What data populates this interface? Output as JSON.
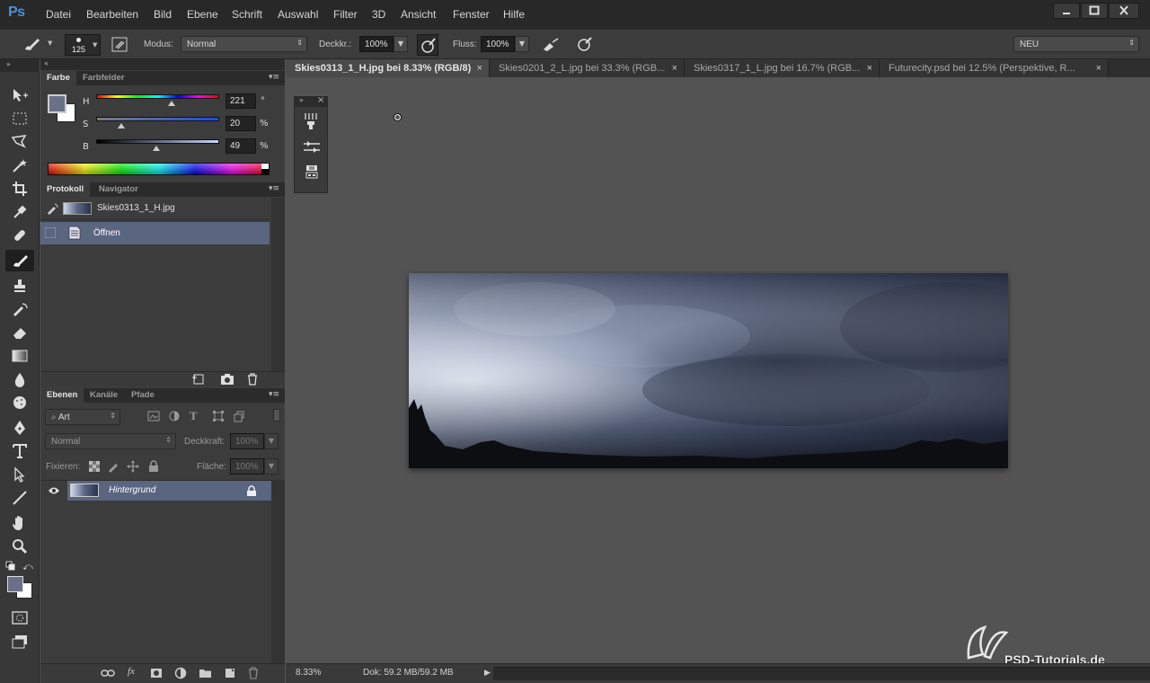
{
  "app": {
    "logo": "Ps"
  },
  "menu": [
    "Datei",
    "Bearbeiten",
    "Bild",
    "Ebene",
    "Schrift",
    "Auswahl",
    "Filter",
    "3D",
    "Ansicht",
    "Fenster",
    "Hilfe"
  ],
  "options": {
    "brush_size": "125",
    "mode_label": "Modus:",
    "mode_value": "Normal",
    "opacity_label": "Deckkr.:",
    "opacity_value": "100%",
    "flow_label": "Fluss:",
    "flow_value": "100%",
    "workspace": "NEU"
  },
  "color_panel": {
    "tabs": [
      "Farbe",
      "Farbfelder"
    ],
    "h_label": "H",
    "h_value": "221",
    "h_unit": "°",
    "s_label": "S",
    "s_value": "20",
    "s_unit": "%",
    "b_label": "B",
    "b_value": "49",
    "b_unit": "%",
    "foreground": "#6b7089",
    "background": "#ffffff"
  },
  "history_panel": {
    "tabs": [
      "Protokoll",
      "Navigator"
    ],
    "snapshot": "Skies0313_1_H.jpg",
    "items": [
      "Öffnen"
    ]
  },
  "layers_panel": {
    "tabs": [
      "Ebenen",
      "Kanäle",
      "Pfade"
    ],
    "filter": "Art",
    "blend": "Normal",
    "opacity_label": "Deckkraft:",
    "opacity_value": "100%",
    "lock_label": "Fixieren:",
    "fill_label": "Fläche:",
    "fill_value": "100%",
    "layers": [
      {
        "name": "Hintergrund"
      }
    ]
  },
  "doc_tabs": [
    {
      "title": "Skies0313_1_H.jpg bei 8.33% (RGB/8)",
      "active": true
    },
    {
      "title": "Skies0201_2_L.jpg bei 33.3% (RGB...",
      "active": false
    },
    {
      "title": "Skies0317_1_L.jpg bei 16.7% (RGB...",
      "active": false
    },
    {
      "title": "Futurecity.psd bei 12.5% (Perspektive, R...",
      "active": false
    }
  ],
  "status": {
    "zoom": "8.33%",
    "doc": "Dok: 59.2 MB/59.2 MB"
  },
  "watermark": "PSD-Tutorials.de",
  "colors": {
    "accent": "#4a90d9",
    "selected_row": "#5a6580"
  }
}
